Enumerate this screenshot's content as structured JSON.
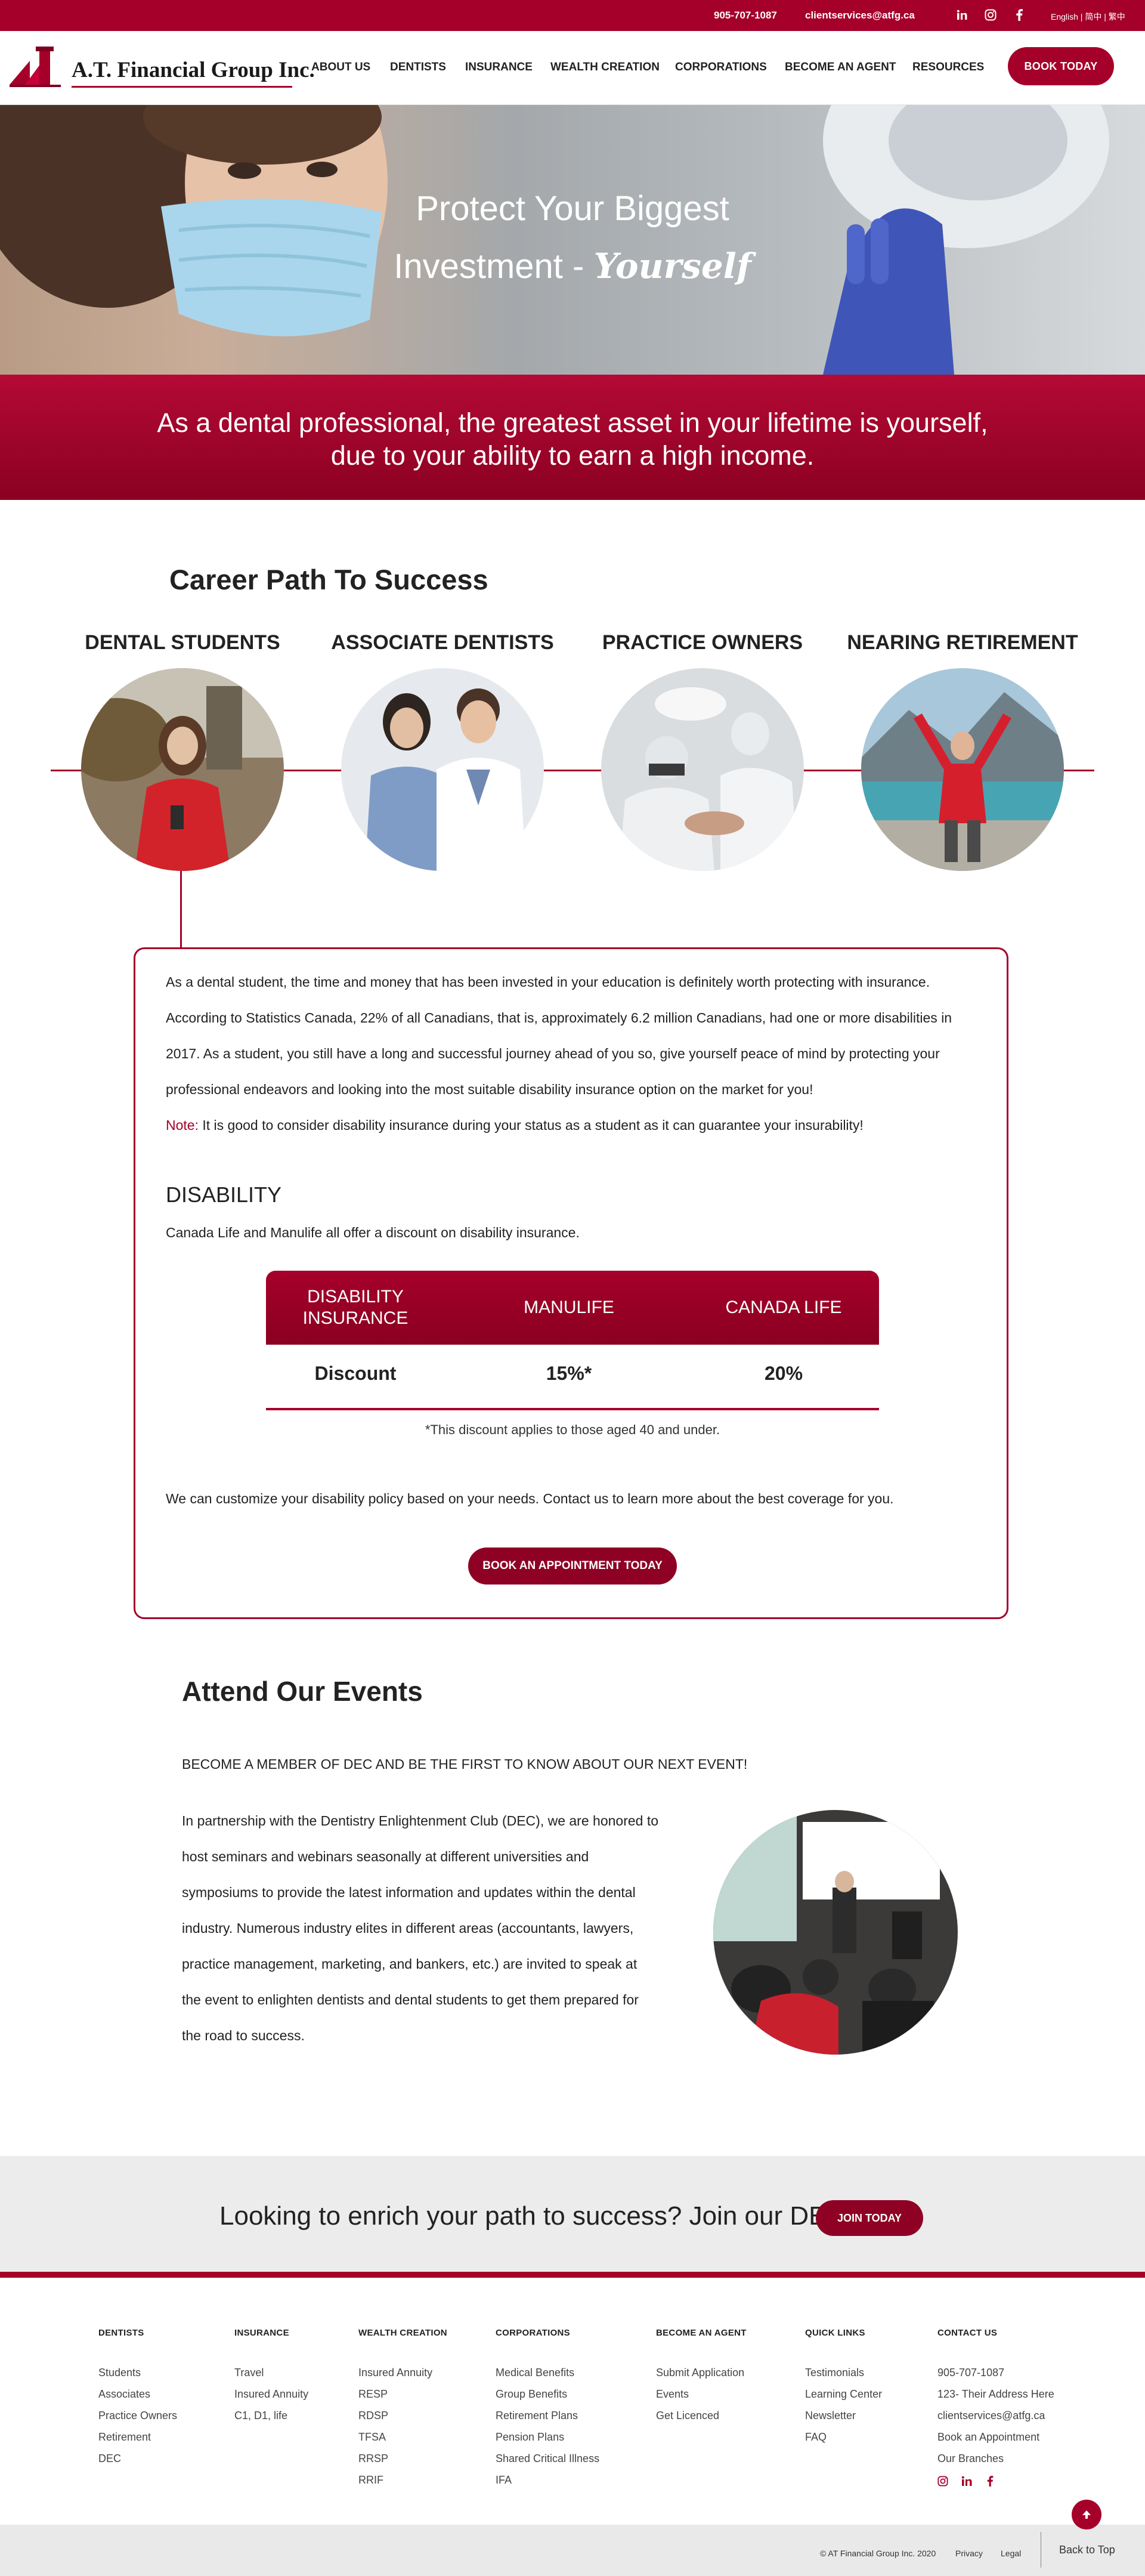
{
  "topbar": {
    "phone": "905-707-1087",
    "email": "clientservices@atfg.ca",
    "language": "English | 简中 | 繁中",
    "social_icons": [
      "linkedin-icon",
      "instagram-icon",
      "facebook-icon"
    ]
  },
  "header": {
    "logo_text": "A.T. Financial Group Inc.",
    "nav": [
      "ABOUT US",
      "DENTISTS",
      "INSURANCE",
      "WEALTH CREATION",
      "CORPORATIONS",
      "BECOME AN AGENT",
      "RESOURCES"
    ],
    "book_button": "BOOK TODAY"
  },
  "hero": {
    "line1": "Protect Your Biggest",
    "line2_prefix": "Investment - ",
    "line2_script": "Yourself"
  },
  "banner": {
    "line1": "As a dental professional, the greatest asset in your lifetime is yourself,",
    "line2": "due to your ability to earn a high income."
  },
  "career": {
    "title": "Career Path To Success",
    "stages": [
      "DENTAL STUDENTS",
      "ASSOCIATE DENTISTS",
      "PRACTICE OWNERS",
      "NEARING RETIREMENT"
    ]
  },
  "info": {
    "paragraph": "As a dental student, the time and money that has been invested in your education is definitely worth protecting with insurance. According to Statistics Canada, 22% of all Canadians, that is, approximately 6.2 million Canadians, had one or more disabilities in 2017. As a student, you still have a long and successful journey ahead of you so, give yourself peace of mind by protecting your professional endeavors and looking into the most suitable disability insurance option on the market for you!",
    "note_label": "Note:",
    "note_text": " It is good to consider disability insurance during your status as a student as it can guarantee your insurability!",
    "disability_title": "DISABILITY",
    "disability_intro": "Canada Life and Manulife all offer a discount on disability insurance.",
    "table": {
      "headers": [
        "DISABILITY INSURANCE",
        "MANULIFE",
        "CANADA LIFE"
      ],
      "row": [
        "Discount",
        "15%*",
        "20%"
      ],
      "footnote": "*This discount applies to those aged 40 and under."
    },
    "customize_text": "We can customize your disability policy based on your needs. Contact us to learn more about the best coverage for you.",
    "appointment_button": "BOOK AN APPOINTMENT TODAY"
  },
  "events": {
    "title": "Attend Our Events",
    "subtitle": "BECOME A MEMBER OF DEC AND BE THE FIRST TO KNOW ABOUT OUR NEXT EVENT!",
    "body": "In partnership with the Dentistry Enlightenment Club (DEC), we are honored to host seminars and webinars seasonally at different universities and symposiums to provide the latest information and updates within the dental industry. Numerous industry elites in different areas (accountants, lawyers, practice management, marketing, and bankers, etc.) are invited to speak at the event to enlighten dentists and dental students to get them prepared for the road to success."
  },
  "cta": {
    "text": "Looking to enrich your path to success? Join our DEC!",
    "button": "JOIN TODAY"
  },
  "footer": {
    "columns": [
      {
        "heading": "DENTISTS",
        "items": [
          "Students",
          "Associates",
          "Practice Owners",
          "Retirement",
          "DEC"
        ]
      },
      {
        "heading": "INSURANCE",
        "items": [
          "Travel",
          "Insured Annuity",
          "C1, D1, life"
        ]
      },
      {
        "heading": "WEALTH CREATION",
        "items": [
          "Insured Annuity",
          "RESP",
          "RDSP",
          "TFSA",
          "RRSP",
          "RRIF"
        ]
      },
      {
        "heading": "CORPORATIONS",
        "items": [
          "Medical Benefits",
          "Group Benefits",
          "Retirement Plans",
          "Pension Plans",
          "Shared Critical Illness",
          "IFA"
        ]
      },
      {
        "heading": "BECOME AN AGENT",
        "items": [
          "Submit Application",
          "Events",
          "Get Licenced"
        ]
      },
      {
        "heading": "QUICK LINKS",
        "items": [
          "Testimonials",
          "Learning Center",
          "Newsletter",
          "FAQ"
        ]
      },
      {
        "heading": "CONTACT US",
        "items": [
          "905-707-1087",
          "123- Their Address Here",
          "clientservices@atfg.ca",
          "Book an Appointment",
          "Our Branches"
        ]
      }
    ],
    "social_icons": [
      "instagram-icon",
      "linkedin-icon",
      "facebook-icon"
    ],
    "copyright": "© AT Financial Group Inc. 2020",
    "privacy": "Privacy",
    "legal": "Legal",
    "back_to_top": "Back to Top"
  },
  "colors": {
    "brand_red": "#a5002a",
    "dark_red": "#8e0024",
    "light_gray": "#ececec"
  }
}
